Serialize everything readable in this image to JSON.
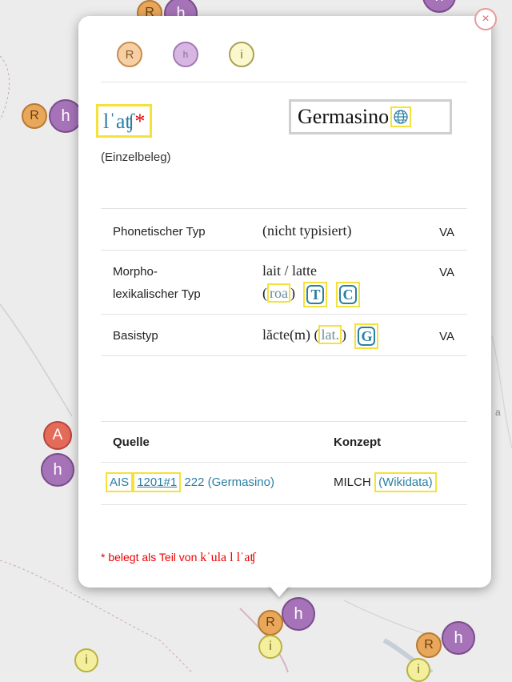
{
  "legend": {
    "r_label": "R",
    "h_label": "h",
    "i_label": "i"
  },
  "map": {
    "marker_h": "h",
    "marker_r": "R",
    "marker_a": "A",
    "marker_i": "i",
    "side_label": "a"
  },
  "close_label": "×",
  "headword": {
    "text": "lˈaʧ",
    "star": "*",
    "note": "(Einzelbeleg)"
  },
  "place": {
    "name": "Germasino",
    "globe_icon": "globe-icon"
  },
  "table": {
    "rows": [
      {
        "label": "Phonetischer Typ",
        "value": "(nicht typisiert)",
        "source": "VA"
      },
      {
        "label_line1": "Morpho-",
        "label_line2": "lexikalischer Typ",
        "value_line1": "lait / latte",
        "lang_prefix": "(",
        "lang": "roa",
        "lang_suffix": ")",
        "btn1": "T",
        "btn2": "C",
        "source": "VA"
      },
      {
        "label": "Basistyp",
        "value": "lăcte(m) (",
        "lang": "lat.",
        "lang_suffix": ")",
        "btn": "G",
        "source": "VA"
      }
    ]
  },
  "sources": {
    "col_source": "Quelle",
    "col_concept": "Konzept",
    "ais": "AIS",
    "ref": "1201#1",
    "rest": " 222 (Germasino)",
    "concept": "MILCH",
    "wikidata": "(Wikidata)"
  },
  "footnote": {
    "prefix": "* belegt als Teil von ",
    "form": "kˈula l lˈaʧ"
  },
  "colors": {
    "accent": "#2a7fa3",
    "highlight": "#f4e23a",
    "star": "#ee0000"
  }
}
